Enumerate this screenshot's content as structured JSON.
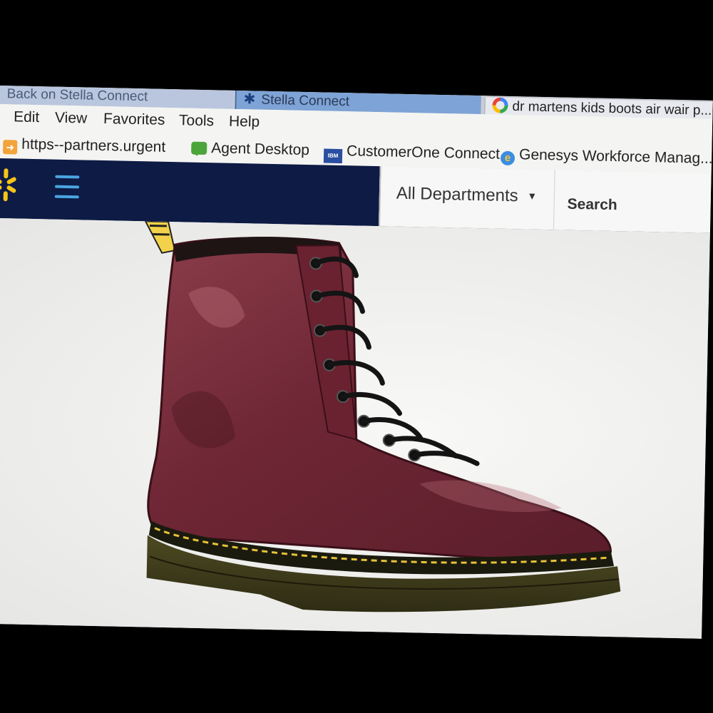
{
  "browser": {
    "tabs": [
      {
        "label": "Back on Stella Connect"
      },
      {
        "label": "Stella Connect"
      },
      {
        "label": "dr martens kids boots air wair p..."
      }
    ],
    "menu": [
      "Edit",
      "View",
      "Favorites",
      "Tools",
      "Help"
    ],
    "favorites": [
      {
        "label": "https--partners.urgent",
        "icon": "arrow-icon"
      },
      {
        "label": "Agent Desktop",
        "icon": "chat-icon"
      },
      {
        "label": "CustomerOne Connect",
        "icon": "ibm-icon"
      },
      {
        "label": "Genesys Workforce Manag...",
        "icon": "ie-icon"
      }
    ]
  },
  "site": {
    "departments_label": "All Departments",
    "search_label": "Search"
  },
  "colors": {
    "header_navy": "#0d1b45",
    "spark_yellow": "#f5c518",
    "hamburger_blue": "#4aa5e0",
    "boot_cherry": "#7a2e3c"
  }
}
